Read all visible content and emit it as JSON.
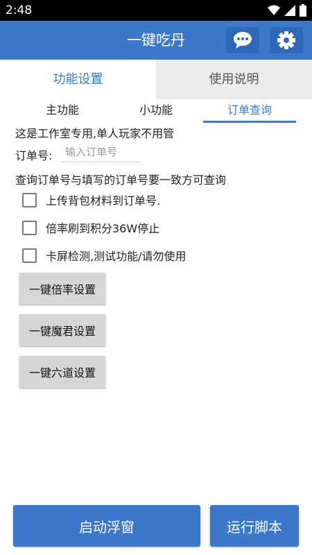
{
  "status_bar": {
    "time": "2:48",
    "icons": [
      "wifi-icon",
      "signal-icon",
      "battery-icon"
    ]
  },
  "app_bar": {
    "title": "一键吃丹",
    "icons": [
      "chat-icon",
      "gear-icon"
    ]
  },
  "tabs": [
    {
      "label": "功能设置",
      "active": true
    },
    {
      "label": "使用说明",
      "active": false
    }
  ],
  "subtabs": [
    {
      "label": "主功能",
      "active": false
    },
    {
      "label": "小功能",
      "active": false
    },
    {
      "label": "订单查询",
      "active": true
    }
  ],
  "content": {
    "notice": "这是工作室专用,单人玩家不用管",
    "order_label": "订单号:",
    "order_value": "",
    "order_placeholder": "输入订单号",
    "query_hint": "查询订单号与填写的订单号要一致方可查询",
    "checkboxes": [
      {
        "label": "上传背包材料到订单号.",
        "checked": false
      },
      {
        "label": "倍率刷到积分36W停止",
        "checked": false
      },
      {
        "label": "卡屏检测,测试功能/请勿使用",
        "checked": false
      }
    ],
    "buttons": [
      "一键倍率设置",
      "一键魔君设置",
      "一键六道设置"
    ]
  },
  "bottom": {
    "float_label": "启动浮窗",
    "run_label": "运行脚本"
  },
  "colors": {
    "primary": "#3b78c9",
    "tab_inactive_bg": "#ececec",
    "button_gray": "#d6d6d6"
  }
}
